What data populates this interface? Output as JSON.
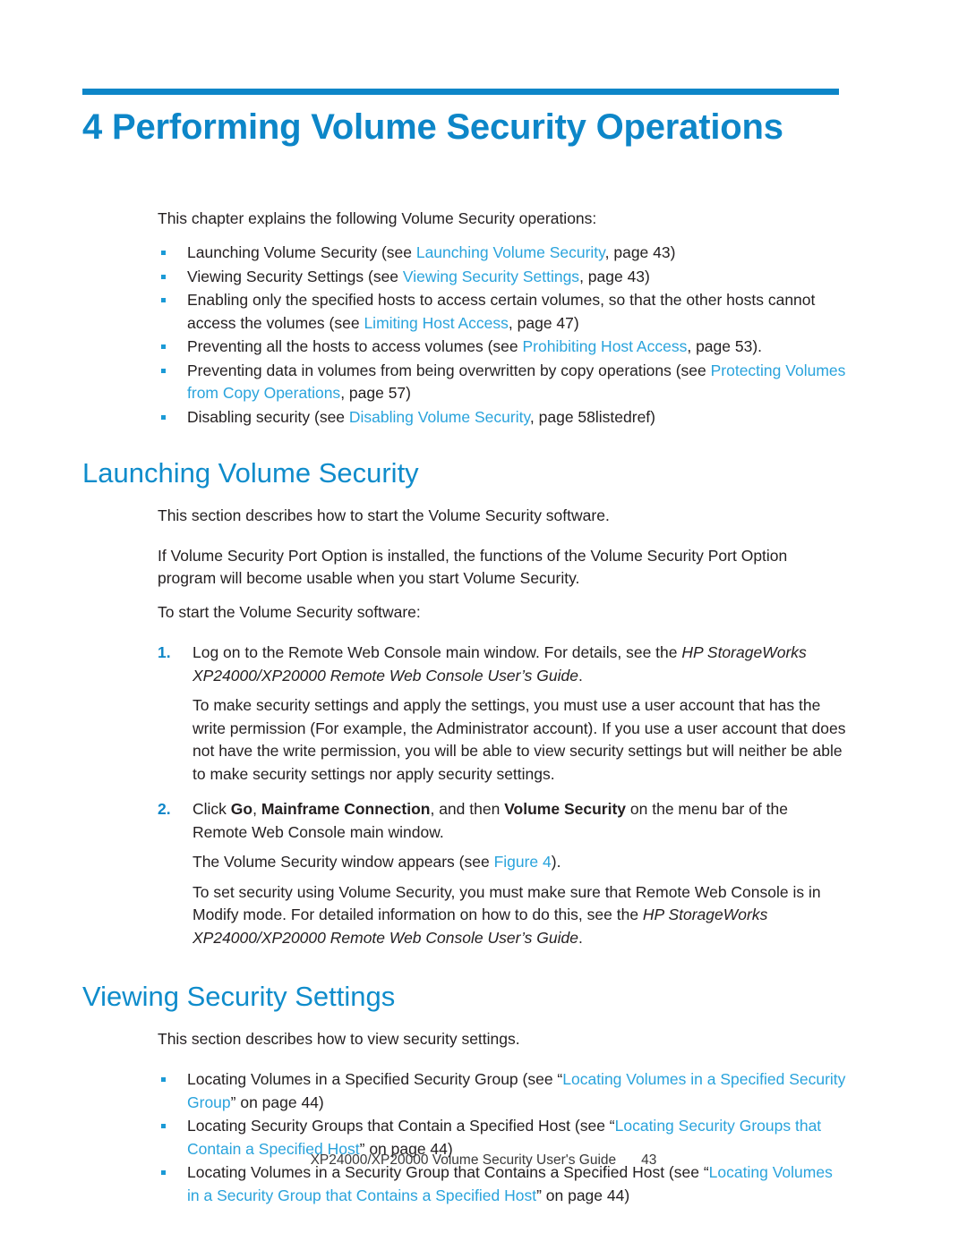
{
  "chapter": {
    "title": "4 Performing Volume Security Operations",
    "rule_color": "#0d86c8",
    "title_color": "#0d86c8"
  },
  "intro": {
    "lead": "This chapter explains the following Volume Security operations:",
    "bullets": [
      {
        "pre": "Launching Volume Security (see ",
        "link": "Launching Volume Security",
        "post": ", page 43)"
      },
      {
        "pre": "Viewing Security Settings (see ",
        "link": "Viewing Security Settings",
        "post": ", page 43)"
      },
      {
        "pre": "Enabling only the specified hosts to access certain volumes, so that the other hosts cannot access the volumes (see ",
        "link": "Limiting Host Access",
        "post": ", page 47)"
      },
      {
        "pre": "Preventing all the hosts to access volumes (see ",
        "link": "Prohibiting Host Access",
        "post": ", page 53)."
      },
      {
        "pre": "Preventing data in volumes from being overwritten by copy operations (see ",
        "link": "Protecting Volumes from Copy Operations",
        "post": ", page 57)"
      },
      {
        "pre": "Disabling security (see ",
        "link": "Disabling Volume Security",
        "post": ", page 58listedref)"
      }
    ]
  },
  "launching": {
    "heading": "Launching Volume Security",
    "heading_color": "#0f8ccb",
    "para1": "This section describes how to start the Volume Security software.",
    "para2": "If Volume Security Port Option is installed, the functions of the Volume Security Port Option program will become usable when you start Volume Security.",
    "para3": "To start the Volume Security software:",
    "steps": [
      {
        "num": "1.",
        "main_pre": "Log on to the Remote Web Console main window. For details, see the ",
        "main_italic": "HP StorageWorks XP24000/XP20000 Remote Web Console User’s Guide",
        "main_post": ".",
        "sub": "To make security settings and apply the settings, you must use a user account that has the write permission (For example, the Administrator account). If you use a user account that does not have the write permission, you will be able to view security settings but will neither be able to make security settings nor apply security settings."
      },
      {
        "num": "2.",
        "click_label": "Click ",
        "bold1": "Go",
        "sep1": ", ",
        "bold2": "Mainframe Connection",
        "sep2": ", and then ",
        "bold3": "Volume Security",
        "tail": " on the menu bar of the Remote Web Console main window.",
        "sub1_pre": "The Volume Security window appears (see ",
        "sub1_link": "Figure 4",
        "sub1_post": ").",
        "sub2_pre": "To set security using Volume Security, you must make sure that Remote Web Console is in Modify mode. For detailed information on how to do this, see the ",
        "sub2_italic": "HP StorageWorks XP24000/XP20000 Remote Web Console User’s Guide",
        "sub2_post": "."
      }
    ]
  },
  "viewing": {
    "heading": "Viewing Security Settings",
    "heading_color": "#0f8ccb",
    "para1": "This section describes how to view security settings.",
    "bullets": [
      {
        "pre": "Locating Volumes in a Specified Security Group (see “",
        "link": "Locating Volumes in a Specified Security Group",
        "post": "” on page 44)"
      },
      {
        "pre": "Locating Security Groups that Contain a Specified Host (see “",
        "link": "Locating Security Groups that Contain a Specified Host",
        "post": "” on page 44)"
      },
      {
        "pre": "Locating Volumes in a Security Group that Contains a Specified Host (see “",
        "link": "Locating Volumes in a Security Group that Contains a Specified Host",
        "post": "” on page 44)"
      }
    ]
  },
  "footer": {
    "guide": "XP24000/XP20000 Volume Security User's Guide",
    "page": "43"
  }
}
